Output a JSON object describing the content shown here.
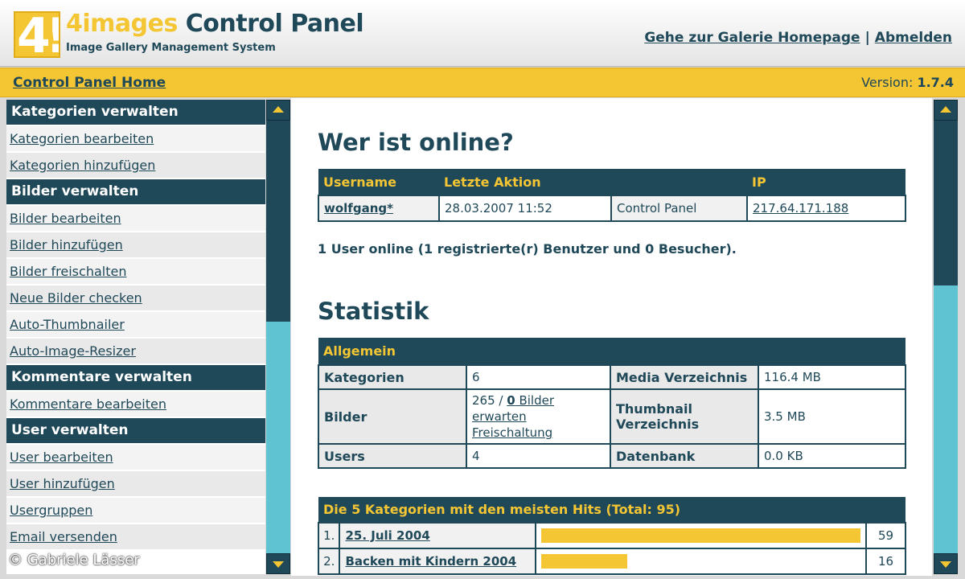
{
  "header": {
    "logo_text": "4!",
    "brand_part1": "4images",
    "brand_part2": " Control Panel",
    "subtitle": "Image Gallery Management System",
    "link_gallery": "Gehe zur Galerie Homepage",
    "separator": "|",
    "link_logout": "Abmelden"
  },
  "crumbbar": {
    "home": "Control Panel Home",
    "version_label": "Version: ",
    "version_value": "1.7.4"
  },
  "sidebar": {
    "sections": [
      {
        "title": "Kategorien verwalten",
        "items": [
          "Kategorien bearbeiten",
          "Kategorien hinzufügen"
        ]
      },
      {
        "title": "Bilder verwalten",
        "items": [
          "Bilder bearbeiten",
          "Bilder hinzufügen",
          "Bilder freischalten",
          "Neue Bilder checken",
          "Auto-Thumbnailer",
          "Auto-Image-Resizer"
        ]
      },
      {
        "title": "Kommentare verwalten",
        "items": [
          "Kommentare bearbeiten"
        ]
      },
      {
        "title": "User verwalten",
        "items": [
          "User bearbeiten",
          "User hinzufügen",
          "Usergruppen",
          "Email versenden"
        ]
      }
    ]
  },
  "online": {
    "heading": "Wer ist online?",
    "columns": {
      "username": "Username",
      "last_action": "Letzte Aktion",
      "ip": "IP"
    },
    "row": {
      "username": "wolfgang*",
      "date": "28.03.2007 11:52",
      "action": "Control Panel",
      "ip": "217.64.171.188"
    },
    "summary": "1 User online (1 registrierte(r) Benutzer und 0 Besucher)."
  },
  "stats": {
    "heading": "Statistik",
    "caption": "Allgemein",
    "categories_label": "Kategorien",
    "categories_value": "6",
    "media_label": "Media Verzeichnis",
    "media_value": "116.4 MB",
    "images_label": "Bilder",
    "images_count": "265 / ",
    "images_pending_count": "0",
    "images_pending_text": " Bilder erwarten Freischaltung",
    "thumb_label": "Thumbnail Verzeichnis",
    "thumb_value": "3.5 MB",
    "users_label": "Users",
    "users_value": "4",
    "db_label": "Datenbank",
    "db_value": "0.0 KB"
  },
  "top_categories": {
    "caption": "Die 5 Kategorien mit den meisten Hits (Total: 95)",
    "rows": [
      {
        "rank": "1.",
        "name": "25. Juli 2004",
        "hits": "59",
        "share": 1.0
      },
      {
        "rank": "2.",
        "name": "Backen mit Kindern 2004",
        "hits": "16",
        "share": 0.27
      }
    ]
  },
  "copyright": "© Gabriele Lässer",
  "colors": {
    "dark_teal": "#1f4858",
    "yellow": "#f4c633",
    "cyan_scroll": "#5fc3d1"
  }
}
